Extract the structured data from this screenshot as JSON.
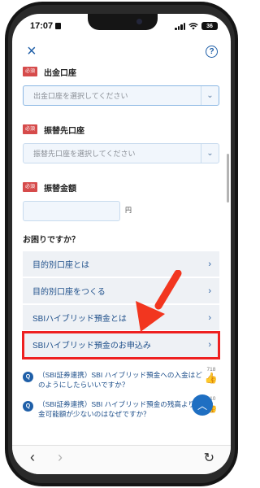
{
  "status": {
    "time": "17:07",
    "battery": "36"
  },
  "nav": {
    "close_icon": "×",
    "help_icon": "?"
  },
  "fields": {
    "required_badge": "必須",
    "source_label": "出金口座",
    "source_placeholder": "出金口座を選択してください",
    "dest_label": "振替先口座",
    "dest_placeholder": "振替先口座を選択してください",
    "amount_label": "振替金額",
    "amount_unit": "円"
  },
  "help": {
    "heading": "お困りですか？",
    "items": [
      {
        "label": "目的別口座とは"
      },
      {
        "label": "目的別口座をつくる"
      },
      {
        "label": "SBIハイブリッド預金とは"
      },
      {
        "label": "SBIハイブリッド預金のお申込み",
        "highlighted": true
      }
    ]
  },
  "faq": {
    "items": [
      {
        "q": "Q",
        "text": "（SBI証券連携）SBI ハイブリッド預金への入金はどのようにしたらいいですか？",
        "count": "718"
      },
      {
        "q": "Q",
        "text": "（SBI証券連携）SBI ハイブリッド預金の残高より、出金可能額が少ないのはなぜですか？",
        "count": "410"
      }
    ]
  },
  "colors": {
    "accent": "#1f5fa8",
    "required": "#d64b4b",
    "highlight": "#ee2020"
  }
}
